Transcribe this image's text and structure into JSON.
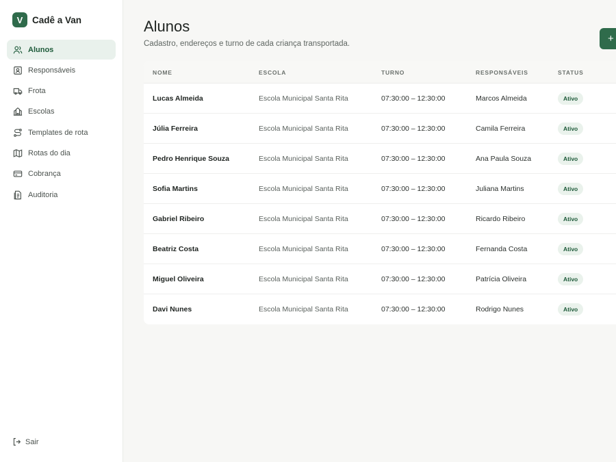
{
  "brand": {
    "logo_letter": "V",
    "name": "Cadê a Van"
  },
  "nav": [
    {
      "label": "Alunos",
      "icon": "users-icon",
      "active": true
    },
    {
      "label": "Responsáveis",
      "icon": "contact-card-icon",
      "active": false
    },
    {
      "label": "Frota",
      "icon": "bus-icon",
      "active": false
    },
    {
      "label": "Escolas",
      "icon": "school-icon",
      "active": false
    },
    {
      "label": "Templates de rota",
      "icon": "route-icon",
      "active": false
    },
    {
      "label": "Rotas do dia",
      "icon": "map-icon",
      "active": false
    },
    {
      "label": "Cobrança",
      "icon": "credit-card-icon",
      "active": false
    },
    {
      "label": "Auditoria",
      "icon": "audit-log-icon",
      "active": false
    }
  ],
  "logout": {
    "label": "Sair",
    "icon": "logout-icon"
  },
  "page": {
    "title": "Alunos",
    "subtitle": "Cadastro, endereços e turno de cada criança transportada.",
    "add_button_symbol": "+"
  },
  "table": {
    "headers": {
      "nome": "NOME",
      "escola": "ESCOLA",
      "turno": "TURNO",
      "responsaveis": "RESPONSÁVEIS",
      "status": "STATUS"
    },
    "rows": [
      {
        "nome": "Lucas Almeida",
        "escola": "Escola Municipal Santa Rita",
        "turno": "07:30:00 – 12:30:00",
        "responsaveis": "Marcos Almeida",
        "status": "Ativo"
      },
      {
        "nome": "Júlia Ferreira",
        "escola": "Escola Municipal Santa Rita",
        "turno": "07:30:00 – 12:30:00",
        "responsaveis": "Camila Ferreira",
        "status": "Ativo"
      },
      {
        "nome": "Pedro Henrique Souza",
        "escola": "Escola Municipal Santa Rita",
        "turno": "07:30:00 – 12:30:00",
        "responsaveis": "Ana Paula Souza",
        "status": "Ativo"
      },
      {
        "nome": "Sofia Martins",
        "escola": "Escola Municipal Santa Rita",
        "turno": "07:30:00 – 12:30:00",
        "responsaveis": "Juliana Martins",
        "status": "Ativo"
      },
      {
        "nome": "Gabriel Ribeiro",
        "escola": "Escola Municipal Santa Rita",
        "turno": "07:30:00 – 12:30:00",
        "responsaveis": "Ricardo Ribeiro",
        "status": "Ativo"
      },
      {
        "nome": "Beatriz Costa",
        "escola": "Escola Municipal Santa Rita",
        "turno": "07:30:00 – 12:30:00",
        "responsaveis": "Fernanda Costa",
        "status": "Ativo"
      },
      {
        "nome": "Miguel Oliveira",
        "escola": "Escola Municipal Santa Rita",
        "turno": "07:30:00 – 12:30:00",
        "responsaveis": "Patrícia Oliveira",
        "status": "Ativo"
      },
      {
        "nome": "Davi Nunes",
        "escola": "Escola Municipal Santa Rita",
        "turno": "07:30:00 – 12:30:00",
        "responsaveis": "Rodrigo Nunes",
        "status": "Ativo"
      }
    ]
  },
  "colors": {
    "accent": "#2f6b4b",
    "active_bg": "#e9f1ec",
    "badge_bg": "#eaf2ec",
    "background": "#f7f7f5"
  }
}
